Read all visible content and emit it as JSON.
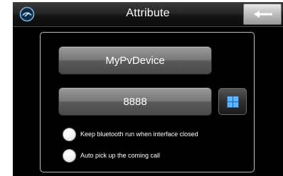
{
  "header": {
    "title": "Attribute",
    "app_icon": "bluetooth-icon",
    "back_icon": "arrow-left-icon"
  },
  "device": {
    "name": "MyPvDevice",
    "pin": "8888",
    "keypad_icon": "keypad-icon"
  },
  "options": [
    {
      "label": "Keep bluetooth run when interface closed",
      "checked": false
    },
    {
      "label": "Auto pick up the coming call",
      "checked": false
    }
  ],
  "colors": {
    "background": "#000000",
    "accent": "#4aa3e8",
    "button": "#6e6e6e",
    "text": "#ffffff"
  }
}
